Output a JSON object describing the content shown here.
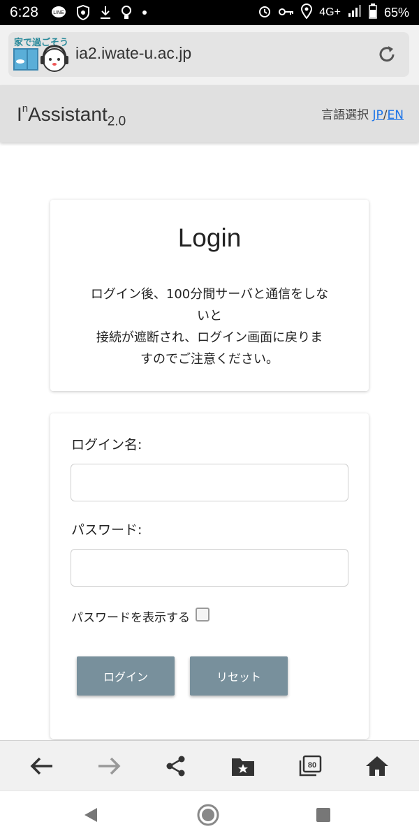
{
  "status_bar": {
    "time": "6:28",
    "network": "4G+",
    "battery": "65%",
    "left_icons": [
      "line-icon",
      "vpn-shield-icon",
      "download-icon",
      "bulb-icon",
      "dot-icon"
    ],
    "right_icons": [
      "alarm-icon",
      "key-icon",
      "location-icon",
      "signal-icon",
      "battery-icon"
    ]
  },
  "browser": {
    "url": "ia2.iwate-u.ac.jp",
    "logo_text": "家で過ごそう",
    "tab_count": "80",
    "accent": "#1a73e8"
  },
  "header": {
    "brand_prefix": "I",
    "brand_sup": "n",
    "brand_main": "Assistant",
    "brand_sub": "2.0",
    "lang_label": "言語選択",
    "lang_jp": "JP",
    "lang_sep": "/",
    "lang_en": "EN"
  },
  "info_card": {
    "title": "Login",
    "note_lines": [
      "ログイン後、100分間サーバと通信をしな",
      "いと",
      "接続が遮断され、ログイン画面に戻りま",
      "すのでご注意ください。"
    ]
  },
  "form": {
    "login_label": "ログイン名:",
    "login_value": "",
    "password_label": "パスワード:",
    "password_value": "",
    "show_password_label": "パスワードを表示する",
    "show_password_checked": false,
    "login_button": "ログイン",
    "reset_button": "リセット",
    "button_color": "#78909c"
  }
}
